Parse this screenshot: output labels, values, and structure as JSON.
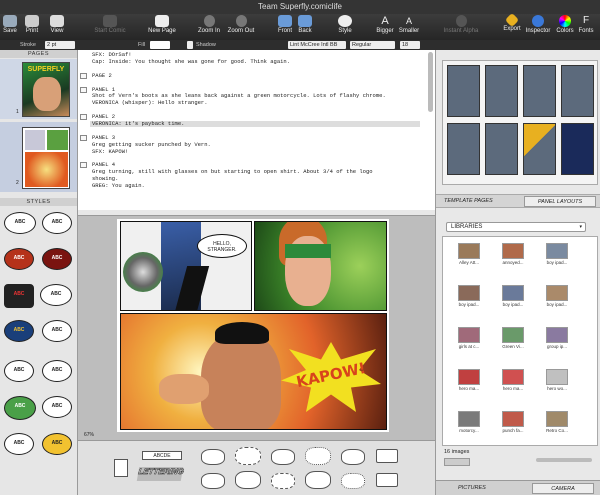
{
  "window": {
    "title": "Team Superfly.comiclife"
  },
  "toolbar": {
    "buttons": [
      {
        "label": "Save",
        "name": "save-button",
        "icon": "floppy-icon"
      },
      {
        "label": "Print",
        "name": "print-button",
        "icon": "printer-icon"
      },
      {
        "label": "View",
        "name": "view-button",
        "icon": "view-icon"
      },
      {
        "label": "Start Comic",
        "name": "start-comic-button",
        "icon": "comic-icon"
      },
      {
        "label": "New Page",
        "name": "new-page-button",
        "icon": "new-page-icon"
      },
      {
        "label": "Zoom In",
        "name": "zoom-in-button",
        "icon": "zoom-in-icon"
      },
      {
        "label": "Zoom Out",
        "name": "zoom-out-button",
        "icon": "zoom-out-icon"
      },
      {
        "label": "Front",
        "name": "front-button",
        "icon": "bring-front-icon"
      },
      {
        "label": "Back",
        "name": "back-button",
        "icon": "send-back-icon"
      },
      {
        "label": "Style",
        "name": "style-button",
        "icon": "style-icon"
      },
      {
        "label": "Bigger",
        "name": "bigger-button",
        "icon": "text-bigger-icon"
      },
      {
        "label": "Smaller",
        "name": "smaller-button",
        "icon": "text-smaller-icon"
      },
      {
        "label": "Instant Alpha",
        "name": "instant-alpha-button",
        "icon": "alpha-icon"
      },
      {
        "label": "Export",
        "name": "export-button",
        "icon": "export-icon"
      },
      {
        "label": "Inspector",
        "name": "inspector-button",
        "icon": "info-icon"
      },
      {
        "label": "Colors",
        "name": "colors-button",
        "icon": "color-wheel-icon"
      },
      {
        "label": "Fonts",
        "name": "fonts-button",
        "icon": "fonts-icon"
      }
    ]
  },
  "format_bar": {
    "stroke_label": "Stroke",
    "stroke_value": "2 pt",
    "fill_label": "Fill",
    "shadow_label": "Shadow",
    "font_value": "Lint McCree Intl BB",
    "style_value": "Regular",
    "size_value": "18"
  },
  "left_panel": {
    "pages_header": "PAGES",
    "page_numbers": [
      "1",
      "2"
    ],
    "cover_title": "SUPERFLY",
    "styles_header": "STYLES",
    "style_labels": [
      "ABC",
      "ABC",
      "ABC",
      "ABC",
      "ABC",
      "ABC",
      "ABC",
      "ABC",
      "ABC",
      "ABC",
      "ABC",
      "ABC",
      "ABC",
      "ABC"
    ]
  },
  "script": {
    "lines": [
      {
        "text": "SFX: DOrSaf!",
        "check": false,
        "hl": false
      },
      {
        "text": "Cap: Inside: You thought she was gone for good. Think again.",
        "check": false,
        "hl": false
      },
      {
        "text": "",
        "check": false,
        "hl": false
      },
      {
        "text": "PAGE 2",
        "check": true,
        "hl": false
      },
      {
        "text": "",
        "check": false,
        "hl": false
      },
      {
        "text": "PANEL 1",
        "check": true,
        "hl": false
      },
      {
        "text": "Shot of Vern's boots as she leans back against a green motorcycle. Lots of flashy chrome.",
        "check": false,
        "hl": false
      },
      {
        "text": "VERONICA (whisper): Hello stranger.",
        "check": false,
        "hl": false
      },
      {
        "text": "",
        "check": false,
        "hl": false
      },
      {
        "text": "PANEL 2",
        "check": true,
        "hl": false
      },
      {
        "text": "VERONICA: it's payback time.",
        "check": false,
        "hl": true
      },
      {
        "text": "",
        "check": false,
        "hl": false
      },
      {
        "text": "PANEL 3",
        "check": true,
        "hl": false
      },
      {
        "text": "Greg getting sucker punched by Vern.",
        "check": false,
        "hl": false
      },
      {
        "text": "SFX: KAPOW!",
        "check": false,
        "hl": false
      },
      {
        "text": "",
        "check": false,
        "hl": false
      },
      {
        "text": "PANEL 4",
        "check": true,
        "hl": false
      },
      {
        "text": "Greg turning, still with glasses on but starting to open shirt. About 3/4 of the logo",
        "check": false,
        "hl": false
      },
      {
        "text": "showing.",
        "check": false,
        "hl": false
      },
      {
        "text": "GREG: You again.",
        "check": false,
        "hl": false
      }
    ]
  },
  "canvas": {
    "balloon_text": "HELLO, STRANGER.",
    "kapow_text": "KAPOW!",
    "zoom": "67%"
  },
  "right_panel": {
    "tabs": [
      "TEMPLATE PAGES",
      "PANEL LAYOUTS"
    ],
    "library_select": "LIBRARIES",
    "library_items": [
      "Alley Att...",
      "annoyed...",
      "boy ipad...",
      "boy ipad...",
      "boy ipad...",
      "boy ipad...",
      "girls at c...",
      "Green Vi...",
      "group ip...",
      "hero ma...",
      "hero ma...",
      "hero wo...",
      "motorcy...",
      "punch fa...",
      "Retro Co..."
    ],
    "count_text": "16 images",
    "bottom_tabs": [
      "PICTURES",
      "CAMERA"
    ]
  },
  "bottom_palette": {
    "labels": [
      "ABCDE",
      "LETTERING"
    ]
  },
  "colors": {
    "toolbar_bg": "#2f2f2f",
    "accent_yellow": "#f2c230",
    "accent_blue": "#2a6ad8",
    "comic_red": "#d8431c",
    "comic_green": "#44a136"
  }
}
